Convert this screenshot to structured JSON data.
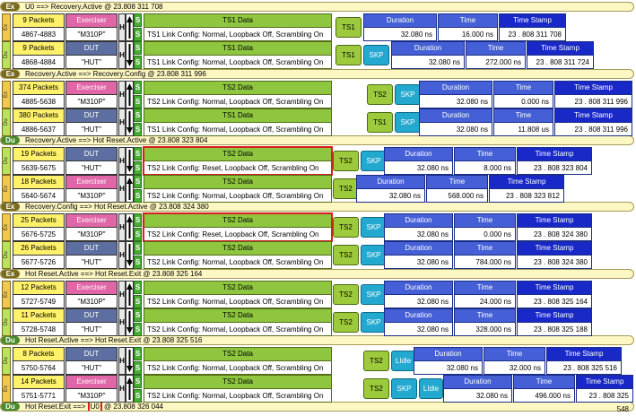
{
  "labels": {
    "packets_suffix": "Packets",
    "exerciser": "Exerciser",
    "dut": "DUT",
    "h": "H",
    "s": "S",
    "duration": "Duration",
    "time": "Time",
    "timestamp": "Time Stamp",
    "ex": "Ex",
    "du": "Du"
  },
  "colors": {
    "exerciser": "#e066a8",
    "dut": "#5c6fa0",
    "data_header": "#8ec63f",
    "duration_header": "#4560d6",
    "timestamp_header": "#1929c8",
    "skp": "#23a8d0",
    "highlight": "#d81e1e",
    "separator_bg": "#fdf7c4"
  },
  "separators": [
    {
      "dir": "Ex",
      "text": "U0 ==> Recovery.Active @ 23.808 311 708"
    },
    {
      "dir": "Ex",
      "text": "Recovery.Active ==> Recovery.Config @ 23.808 311 996"
    },
    {
      "dir": "Du",
      "text": "Recovery.Active ==> Hot Reset.Active @ 23.808 323 804"
    },
    {
      "dir": "Ex",
      "text": "Recovery.Config ==> Hot Reset.Active @ 23.808 324 380"
    },
    {
      "dir": "Ex",
      "text": "Hot Reset.Active ==> Hot Reset.Exit @ 23.808 325 164"
    },
    {
      "dir": "Du",
      "text": "Hot Reset.Active ==> Hot Reset.Exit @ 23.808 325 516"
    },
    {
      "dir": "Du",
      "text_before": "Hot Reset.Exit ==> ",
      "text_hl": "U0",
      "text_after": " @ 23.808 326 044"
    }
  ],
  "rows": [
    {
      "packets": "9 Packets",
      "range": "4867-4883",
      "role": "Exerciser",
      "link": "\"M310P\"",
      "data_title": "TS1 Data",
      "data": "TS1 Link Config: Normal, Loopback Off, Scrambling On",
      "tags": [
        "TS1"
      ],
      "duration": "32.080 ns",
      "time": "16.000 ns",
      "timestamp": "23 . 808 311 708"
    },
    {
      "packets": "9 Packets",
      "range": "4868-4884",
      "role": "DUT",
      "link": "\"HUT\"",
      "data_title": "TS1 Data",
      "data": "TS1 Link Config: Normal, Loopback Off, Scrambling On",
      "tags": [
        "TS1",
        "SKP"
      ],
      "duration": "32.080 ns",
      "time": "272.000 ns",
      "timestamp": "23 . 808 311 724"
    },
    {
      "packets": "374 Packets",
      "range": "4885-5638",
      "role": "Exerciser",
      "link": "\"M310P\"",
      "data_title": "TS2 Data",
      "data": "TS2 Link Config: Normal, Loopback Off, Scrambling On",
      "tags": [
        "TS2",
        "SKP"
      ],
      "duration": "32.080 ns",
      "time": "0.000 ns",
      "timestamp": "23 . 808 311 996"
    },
    {
      "packets": "380 Packets",
      "range": "4886-5637",
      "role": "DUT",
      "link": "\"HUT\"",
      "data_title": "TS1 Data",
      "data": "TS1 Link Config: Normal, Loopback Off, Scrambling On",
      "tags": [
        "TS1",
        "SKP"
      ],
      "duration": "32.080 ns",
      "time": "11.808 us",
      "timestamp": "23 . 808 311 996"
    },
    {
      "packets": "19 Packets",
      "range": "5639-5675",
      "role": "DUT",
      "link": "\"HUT\"",
      "data_title": "TS2 Data",
      "data": "TS2 Link Config: Reset, Loopback Off, Scrambling On",
      "tags": [
        "TS2",
        "SKP"
      ],
      "duration": "32.080 ns",
      "time": "8.000 ns",
      "timestamp": "23 . 808 323 804"
    },
    {
      "packets": "18 Packets",
      "range": "5640-5674",
      "role": "Exerciser",
      "link": "\"M310P\"",
      "data_title": "TS2 Data",
      "data": "TS2 Link Config: Normal, Loopback Off, Scrambling On",
      "tags": [
        "TS2"
      ],
      "duration": "32.080 ns",
      "time": "568.000 ns",
      "timestamp": "23 . 808 323 812"
    },
    {
      "packets": "25 Packets",
      "range": "5676-5725",
      "role": "Exerciser",
      "link": "\"M310P\"",
      "data_title": "TS2 Data",
      "data": "TS2 Link Config: Reset, Loopback Off, Scrambling On",
      "tags": [
        "TS2",
        "SKP"
      ],
      "duration": "32.080 ns",
      "time": "0.000 ns",
      "timestamp": "23 . 808 324 380"
    },
    {
      "packets": "26 Packets",
      "range": "5677-5726",
      "role": "DUT",
      "link": "\"HUT\"",
      "data_title": "TS2 Data",
      "data": "TS2 Link Config: Normal, Loopback Off, Scrambling On",
      "tags": [
        "TS2",
        "SKP"
      ],
      "duration": "32.080 ns",
      "time": "784.000 ns",
      "timestamp": "23 . 808 324 380"
    },
    {
      "packets": "12 Packets",
      "range": "5727-5749",
      "role": "Exerciser",
      "link": "\"M310P\"",
      "data_title": "TS2 Data",
      "data": "TS2 Link Config: Normal, Loopback Off, Scrambling On",
      "tags": [
        "TS2",
        "SKP"
      ],
      "duration": "32.080 ns",
      "time": "24.000 ns",
      "timestamp": "23 . 808 325 164"
    },
    {
      "packets": "11 Packets",
      "range": "5728-5748",
      "role": "DUT",
      "link": "\"HUT\"",
      "data_title": "TS2 Data",
      "data": "TS2 Link Config: Normal, Loopback Off, Scrambling On",
      "tags": [
        "TS2",
        "SKP"
      ],
      "duration": "32.080 ns",
      "time": "328.000 ns",
      "timestamp": "23 . 808 325 188"
    },
    {
      "packets": "8 Packets",
      "range": "5750-5764",
      "role": "DUT",
      "link": "\"HUT\"",
      "data_title": "TS2 Data",
      "data": "TS2 Link Config: Normal, Loopback Off, Scrambling On",
      "tags": [
        "TS2",
        "LIdle"
      ],
      "duration": "32.080 ns",
      "time": "32.000 ns",
      "timestamp": "23 . 808 325 516"
    },
    {
      "packets": "14 Packets",
      "range": "5751-5771",
      "role": "Exerciser",
      "link": "\"M310P\"",
      "data_title": "TS2 Data",
      "data": "TS2 Link Config: Normal, Loopback Off, Scrambling On",
      "tags": [
        "TS2",
        "SKP",
        "LIdle"
      ],
      "duration": "32.080 ns",
      "time": "496.000 ns",
      "timestamp": "23 . 808 325 548"
    }
  ]
}
